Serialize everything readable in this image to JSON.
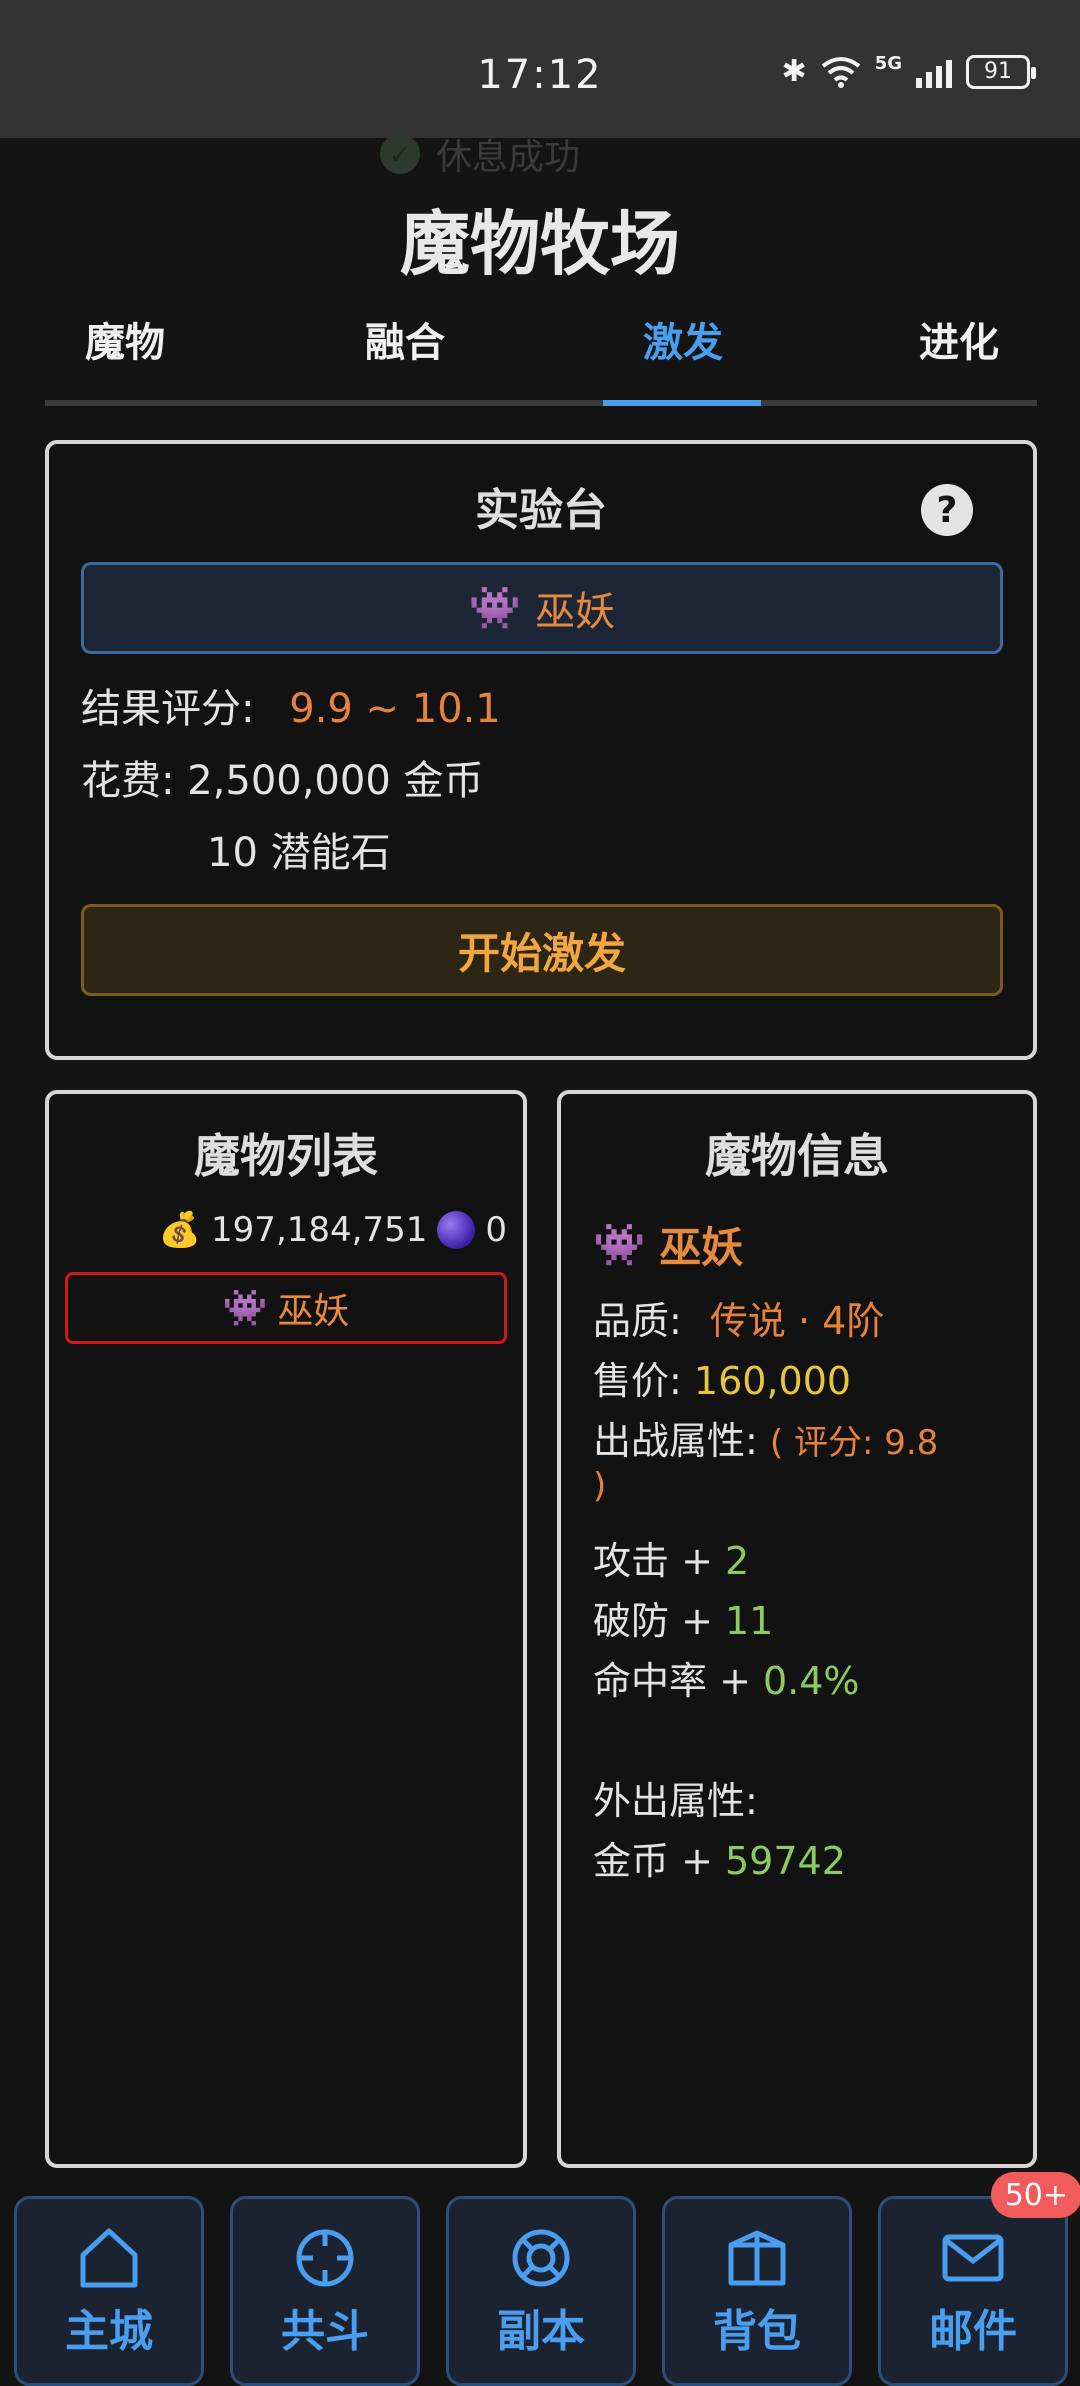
{
  "status_bar": {
    "time": "17:12",
    "network": "5G",
    "battery": "91"
  },
  "toast": {
    "text": "休息成功"
  },
  "page_title": "魔物牧场",
  "tabs": [
    {
      "label": "魔物",
      "active": false
    },
    {
      "label": "融合",
      "active": false
    },
    {
      "label": "激发",
      "active": true
    },
    {
      "label": "进化",
      "active": false
    }
  ],
  "lab": {
    "title": "实验台",
    "help_label": "?",
    "selected_monster": "巫妖",
    "result_label": "结果评分:",
    "result_value": "9.9 ~ 10.1",
    "cost_label": "花费:",
    "cost_gold": "2,500,000 金币",
    "cost_stone": "10 潜能石",
    "start_button": "开始激发"
  },
  "monster_list": {
    "title": "魔物列表",
    "gold": "197,184,751",
    "stones": "0",
    "items": [
      {
        "name": "巫妖",
        "selected": true
      }
    ]
  },
  "monster_info": {
    "title": "魔物信息",
    "name": "巫妖",
    "quality_label": "品质:",
    "quality_value": "传说 · 4阶",
    "price_label": "售价:",
    "price_value": "160,000",
    "battle_label": "出战属性:",
    "battle_score_open": "( 评分: 9.8",
    "battle_score_close": ")",
    "battle_attrs": [
      {
        "label": "攻击 + ",
        "value": "2"
      },
      {
        "label": "破防 + ",
        "value": "11"
      },
      {
        "label": "命中率 + ",
        "value": "0.4%"
      }
    ],
    "out_label": "外出属性:",
    "out_attrs": [
      {
        "label": "金币 + ",
        "value": "59742"
      }
    ]
  },
  "bottom_nav": {
    "items": [
      {
        "label": "主城",
        "icon": "home-icon"
      },
      {
        "label": "共斗",
        "icon": "crosshair-icon"
      },
      {
        "label": "副本",
        "icon": "lifebuoy-icon"
      },
      {
        "label": "背包",
        "icon": "box-icon"
      },
      {
        "label": "邮件",
        "icon": "mail-icon"
      }
    ],
    "mail_badge": "50+"
  },
  "colors": {
    "accent": "#4a9ef0",
    "rarity": "#e8823a",
    "bonus": "#8ccc5e",
    "price": "#e8c53a",
    "danger": "#d01818"
  }
}
